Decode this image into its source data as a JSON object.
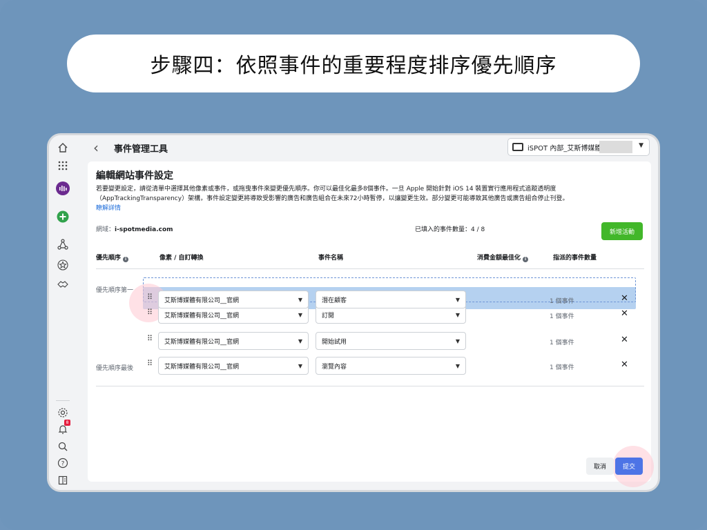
{
  "banner": {
    "title": "步驟四：依照事件的重要程度排序優先順序"
  },
  "sidebar": {
    "icons": [
      "home-icon",
      "apps-grid-icon",
      "brand-logo-icon",
      "add-icon",
      "network-icon",
      "star-icon",
      "handshake-icon",
      "settings-icon",
      "notifications-icon",
      "search-icon",
      "help-icon",
      "reports-icon"
    ],
    "notification_badge": "8"
  },
  "topbar": {
    "back_label": "‹",
    "title": "事件管理工具",
    "account_name": "iSPOT 內部_艾斯博媒體"
  },
  "panel": {
    "title": "編輯網站事件設定",
    "description": "若要變更設定，請從清單中選擇其他像素或事件，或拖曳事件來變更優先順序。你可以最佳化最多8個事件。一旦 Apple 開始針對 iOS 14 裝置實行應用程式追蹤透明度（AppTrackingTransparency）架構，事件設定變更將導致受影響的廣告和廣告組合在未來72小時暫停，以讓變更生效。部分變更可能導致其他廣告或廣告組合停止刊登。",
    "learn_more": "瞭解詳情",
    "domain_label": "網域：",
    "domain_value": "i-spotmedia.com",
    "event_count": "已填入的事件數量：4 / 8",
    "add_button": "新增活動"
  },
  "table": {
    "headers": {
      "priority": "優先順序",
      "pixel": "像素 / 自訂轉換",
      "event_name": "事件名稱",
      "value_opt": "消費金額最佳化",
      "assigned": "指派的事件數量"
    },
    "priority_first": "優先順序第一",
    "priority_last": "優先順序最後",
    "rows": [
      {
        "pixel": "艾斯博媒體有限公司__官網",
        "event": "潛在顧客",
        "assigned": "1 個事件"
      },
      {
        "pixel": "艾斯博媒體有限公司__官網",
        "event": "訂閱",
        "assigned": "1 個事件"
      },
      {
        "pixel": "艾斯博媒體有限公司__官網",
        "event": "開始試用",
        "assigned": "1 個事件"
      },
      {
        "pixel": "艾斯博媒體有限公司__官網",
        "event": "瀏覽內容",
        "assigned": "1 個事件"
      }
    ]
  },
  "footer": {
    "cancel": "取消",
    "submit": "提交"
  }
}
